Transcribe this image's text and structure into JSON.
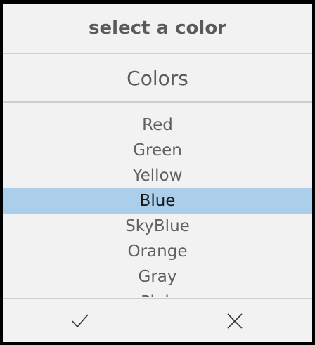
{
  "dialog": {
    "title": "select a color",
    "header": "Colors"
  },
  "list": {
    "items": [
      {
        "label": "Red"
      },
      {
        "label": "Green"
      },
      {
        "label": "Yellow"
      },
      {
        "label": "Blue",
        "selected": true
      },
      {
        "label": "SkyBlue"
      },
      {
        "label": "Orange"
      },
      {
        "label": "Gray"
      },
      {
        "label": "Pink"
      }
    ],
    "selected_index": 3
  },
  "footer": {
    "accept_icon": "checkmark-icon",
    "cancel_icon": "close-icon"
  },
  "colors": {
    "background": "#f2f2f2",
    "selection": "#abcfea",
    "text": "#5a5a5a",
    "divider": "#cfcfcf"
  }
}
